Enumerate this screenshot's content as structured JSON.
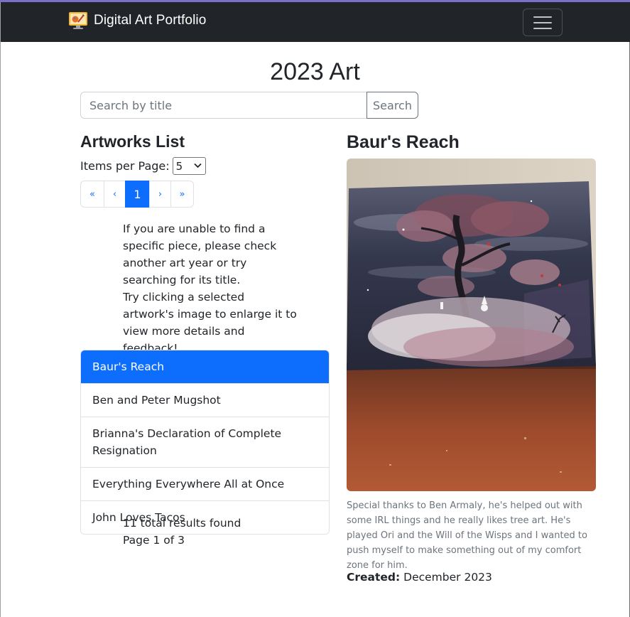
{
  "navbar": {
    "brand": "Digital Art Portfolio",
    "logo_icon": "palette-monitor-icon",
    "menu_icon": "hamburger-icon"
  },
  "page": {
    "title": "2023 Art"
  },
  "search": {
    "placeholder": "Search by title",
    "value": "",
    "button_label": "Search"
  },
  "list_panel": {
    "heading": "Artworks List",
    "items_per_page_label": "Items per Page:",
    "items_per_page_value": "5",
    "pagination": {
      "first": "«",
      "prev": "‹",
      "current": "1",
      "next": "›",
      "last": "»"
    },
    "help_text": {
      "line1": "If you are unable to find a specific piece, please check another art year or try searching for its title.",
      "line2": "Try clicking a selected artwork's image to enlarge it to view more details and feedback!"
    },
    "items": [
      {
        "label": "Baur's Reach",
        "active": true
      },
      {
        "label": "Ben and Peter Mugshot",
        "active": false
      },
      {
        "label": "Brianna's Declaration of Complete Resignation",
        "active": false
      },
      {
        "label": "Everything Everywhere All at Once",
        "active": false
      },
      {
        "label": "John Loves Tacos",
        "active": false
      }
    ],
    "total_results": "11 total results found",
    "page_info": "Page 1 of 3"
  },
  "detail": {
    "title": "Baur's Reach",
    "caption": "Special thanks to Ben Armaly, he's helped out with some IRL things and he really likes tree art. He's played Ori and the Will of the Wisps and I wanted to push myself to make something out of my comfort zone for him.",
    "created_label": "Created:",
    "created_value": "December 2023"
  },
  "colors": {
    "navbar_bg": "#212529",
    "primary": "#0d6efd",
    "muted": "#6c757d"
  }
}
